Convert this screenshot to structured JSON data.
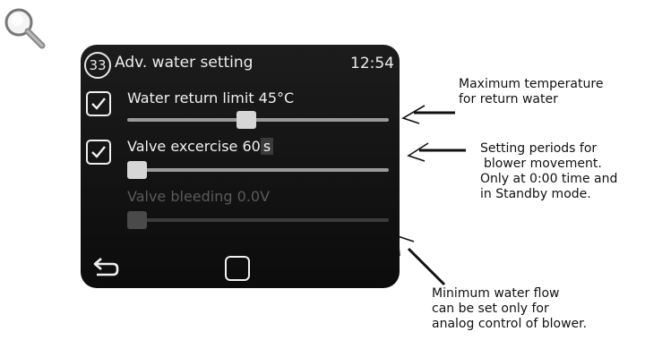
{
  "icons": {
    "magnifier": "magnifier-icon",
    "back": "back-arrow-icon",
    "home": "home-square-icon",
    "check": "checkmark-icon"
  },
  "colors": {
    "screen_bg": "#111111",
    "text": "#f0f0f0",
    "disabled_text": "#5a5a5a",
    "slider_track": "#9a9a9a",
    "slider_thumb": "#d6d6d6"
  },
  "screen": {
    "number": "33",
    "title": "Adv. water setting",
    "clock": "12:54",
    "settings": [
      {
        "label": "Water return limit 45°C",
        "enabled": true,
        "checked": true,
        "slider_level": 0.45
      },
      {
        "label_prefix": "Valve excercise 60",
        "label_value_suffix": "s",
        "enabled": true,
        "checked": true,
        "slider_level": 0.0
      },
      {
        "label": "Valve bleeding 0.0V",
        "enabled": false,
        "checked": false,
        "slider_level": 0.0
      }
    ]
  },
  "annotations": {
    "return_water": [
      "Maximum temperature",
      "for return water"
    ],
    "valve_exercise": [
      "Setting periods for",
      "blower movement.",
      "Only at 0:00 time and",
      "in Standby mode."
    ],
    "valve_bleeding": [
      "Minimum water flow",
      "can be set only for",
      "analog control of blower."
    ]
  }
}
